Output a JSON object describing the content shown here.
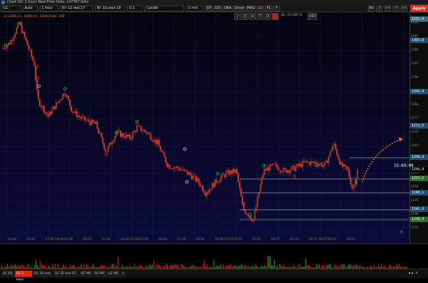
{
  "window": {
    "title": "Chart (GC 1 hour) Real-Time Data: 147767 ticks"
  },
  "toolbar": {
    "symbol": "GC",
    "mode": "Auto",
    "interval": "1 hour",
    "from": "Вт 12.янв.17",
    "to": "Вт 10.июл.18",
    "value": "0,1",
    "style": "Candle",
    "period": "5 min",
    "buttons": [
      "DP",
      "DD",
      "DBA",
      "Draw",
      "MAG",
      "LO",
      "PL",
      "F"
    ],
    "right_buttons": [
      "All",
      "-?",
      "+?",
      "-?",
      "+?"
    ],
    "apply_label": "Apply"
  },
  "ohlc_readout": "H: 1256,3 L: 1256,0 C: 1256,4    Vol: 324",
  "draw_tools": [
    "/",
    "[]",
    "O",
    "T",
    "D"
  ],
  "draw_params": {
    "label": "Op. (0.100) %",
    "value": "100"
  },
  "price_axis": {
    "ticks": [
      "1310",
      "1305",
      "1300",
      "1295",
      "1290",
      "1285",
      "1280",
      "1275",
      "1270",
      "1265",
      "1260",
      "1255",
      "1250",
      "1245",
      "1240",
      "1235"
    ],
    "tags": [
      {
        "text": "1311,4",
        "color": "#3a6a8a"
      },
      {
        "text": "1303,8",
        "color": "#1f4f6f"
      },
      {
        "text": "1284,9",
        "color": "#1f4f6f"
      },
      {
        "text": "1272,6",
        "color": "#1f4f6f"
      },
      {
        "text": "1260,9",
        "color": "#1f4f6f"
      },
      {
        "text": "1256,4",
        "color": "#000000"
      },
      {
        "text": "1253,2",
        "color": "#2a6a2a"
      },
      {
        "text": "1248,1",
        "color": "#1f4f6f"
      },
      {
        "text": "1241,9",
        "color": "#1f4f6f"
      },
      {
        "text": "1238,3",
        "color": "#2a6a2a"
      }
    ]
  },
  "current_time": "15:09:08",
  "time_axis": [
    "14.06",
    "15.06",
    "17.06 18.06",
    "19.06",
    "20.06",
    "21.06",
    "22.06 24.06",
    "25.06",
    "26.06",
    "27.06",
    "28.06",
    "29.06 01.07",
    "02.07",
    "03.07",
    "04.07",
    "05.07",
    "06.07 08.07",
    "09.07",
    "10.07"
  ],
  "tabs": [
    "GC D1",
    "GC 1 hour",
    "GC 15 min",
    "GC 15 min ST",
    "GC M5",
    "GC M1",
    "GC M1"
  ],
  "colors": {
    "up": "#c8501a",
    "down": "#e03030",
    "accent": "#ff6a2a",
    "apply": "#e0281c"
  }
}
